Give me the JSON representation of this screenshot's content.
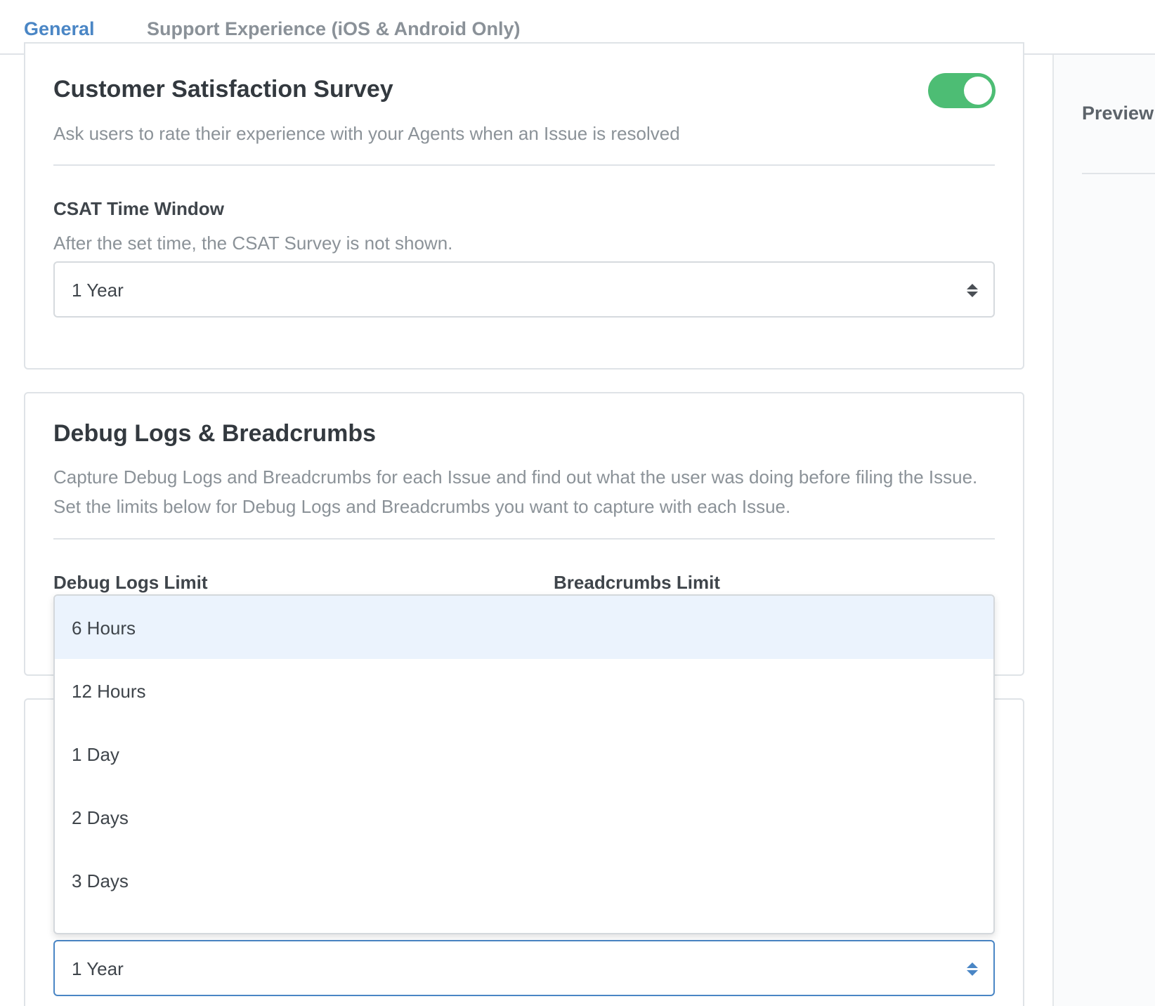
{
  "tabs": [
    {
      "label": "General",
      "active": true
    },
    {
      "label": "Support Experience (iOS & Android Only)",
      "active": false
    }
  ],
  "preview": {
    "title": "Preview"
  },
  "csat": {
    "title": "Customer Satisfaction Survey",
    "description": "Ask users to rate their experience with your Agents when an Issue is resolved",
    "toggle_on": true,
    "time_window": {
      "label": "CSAT Time Window",
      "help": "After the set time, the CSAT Survey is not shown.",
      "value": "1 Year"
    }
  },
  "debug": {
    "title": "Debug Logs & Breadcrumbs",
    "description_line1": "Capture Debug Logs and Breadcrumbs for each Issue and find out what the user was doing before filing the Issue.",
    "description_line2": "Set the limits below for Debug Logs and Breadcrumbs you want to capture with each Issue.",
    "debug_logs_label": "Debug Logs Limit",
    "breadcrumbs_label": "Breadcrumbs Limit"
  },
  "dropdown": {
    "options": [
      "6 Hours",
      "12 Hours",
      "1 Day",
      "2 Days",
      "3 Days"
    ],
    "highlighted_index": 0
  },
  "lower_select": {
    "value": "1 Year"
  },
  "colors": {
    "accent": "#4a86c5",
    "toggle_on": "#4dbd74",
    "option_highlight": "#ebf3fd"
  }
}
